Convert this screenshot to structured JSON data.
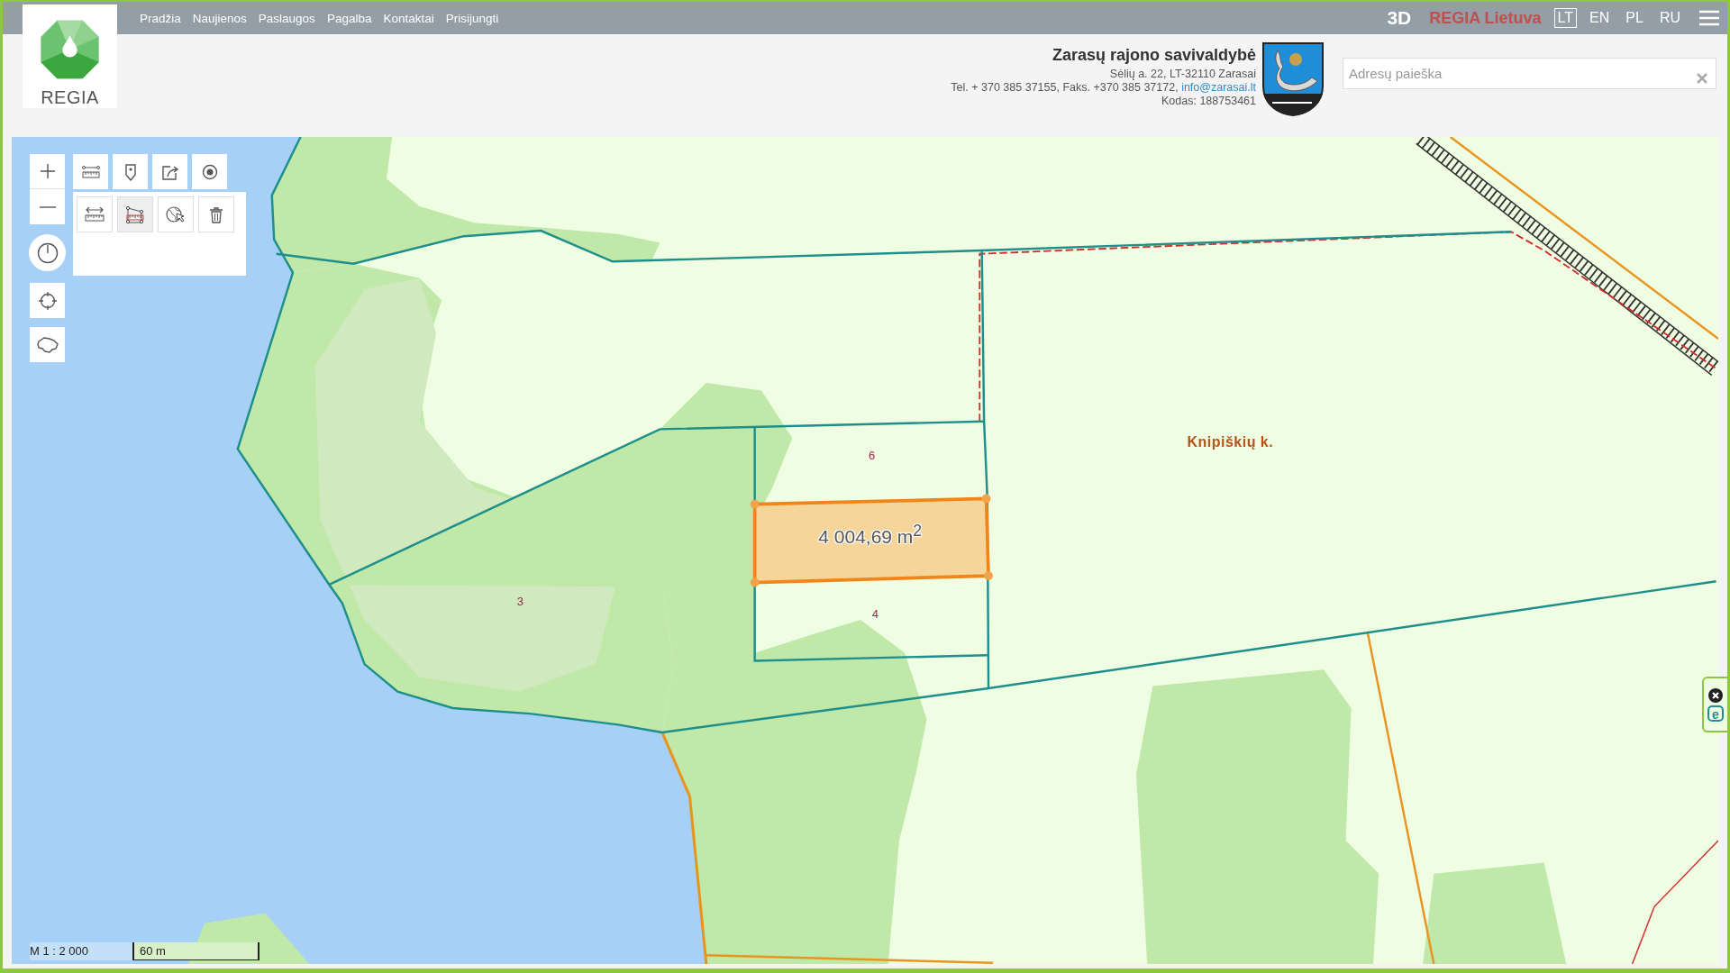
{
  "nav": {
    "links": [
      {
        "label": "Pradžia"
      },
      {
        "label": "Naujienos"
      },
      {
        "label": "Paslaugos"
      },
      {
        "label": "Pagalba"
      },
      {
        "label": "Kontaktai"
      },
      {
        "label": "Prisijungti"
      }
    ],
    "view_toggle": "3D",
    "brand": "REGIA Lietuva",
    "languages": [
      {
        "label": "LT",
        "selected": true
      },
      {
        "label": "EN",
        "selected": false
      },
      {
        "label": "PL",
        "selected": false
      },
      {
        "label": "RU",
        "selected": false
      }
    ]
  },
  "logo": {
    "text": "REGIA"
  },
  "municipality": {
    "name": "Zarasų rajono savivaldybė",
    "address": "Sėlių a. 22, LT-32110 Zarasai",
    "contacts": "Tel. + 370 385 37155, Faks. +370 385 37172,",
    "email": "info@zarasai.lt",
    "code": "Kodas: 188753461"
  },
  "search": {
    "placeholder": "Adresų paieška"
  },
  "map_tools": {
    "main": [
      {
        "kind": "measure"
      },
      {
        "kind": "marker"
      },
      {
        "kind": "share"
      },
      {
        "kind": "record"
      }
    ],
    "measure_panel": [
      {
        "kind": "distance",
        "selected": false
      },
      {
        "kind": "area",
        "selected": true
      },
      {
        "kind": "select",
        "selected": false
      },
      {
        "kind": "delete",
        "selected": false
      }
    ]
  },
  "map": {
    "labels": [
      {
        "kind": "parcel",
        "text": "6"
      },
      {
        "kind": "parcel",
        "text": "4"
      },
      {
        "kind": "parcel",
        "text": "3"
      },
      {
        "kind": "place",
        "text": "Knipiškių k."
      }
    ],
    "measurement": "4 004,69 m$^{2}$"
  },
  "scale": {
    "ratio": "M 1 : 2 000",
    "bar": "60 m"
  },
  "side_widget": {
    "letter": "e"
  }
}
